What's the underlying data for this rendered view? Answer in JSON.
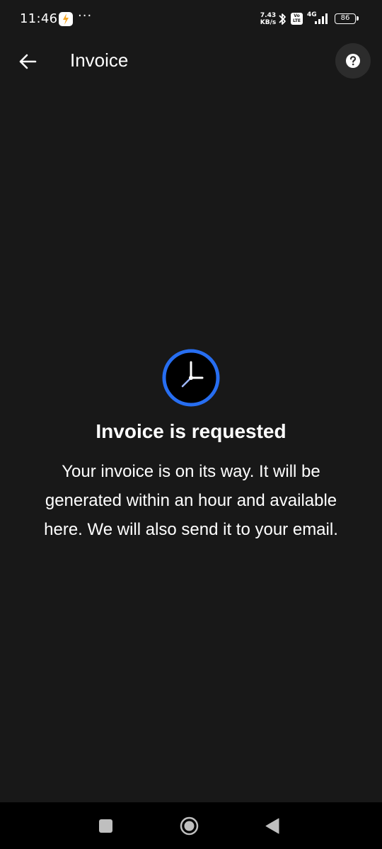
{
  "status_bar": {
    "time": "11:46",
    "more": "···",
    "net_speed_value": "7.43",
    "net_speed_unit": "KB/s",
    "volte_top": "Vo",
    "volte_bottom": "LTE",
    "network_type": "4G",
    "battery": "86"
  },
  "app_bar": {
    "title": "Invoice",
    "back_icon": "arrow-left-icon",
    "help_icon": "question-circle-icon"
  },
  "content": {
    "icon": "clock-icon",
    "headline": "Invoice is requested",
    "message": "Your invoice is on its way. It will be generated within an hour and available here. We will also send it to your email."
  },
  "colors": {
    "background": "#181818",
    "accent_ring": "#276ef1",
    "help_button_bg": "#2c2c2c",
    "nav_bar_bg": "#000000"
  }
}
